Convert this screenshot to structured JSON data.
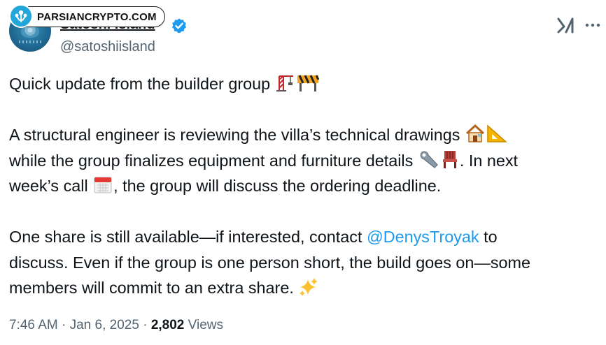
{
  "watermark": {
    "text": "PARSIANCRYPTO.COM"
  },
  "author": {
    "display_name": "Satoshi Island",
    "handle": "@satoshiisland",
    "verified": true,
    "avatar_icon": "island-avatar"
  },
  "tweet": {
    "line1": "Quick update from the builder group",
    "p2_a": "A structural engineer is reviewing the villa’s technical drawings",
    "p2_b": "while the group finalizes equipment and furniture details",
    "p2_c": ". In next",
    "p2_d": "week’s call",
    "p2_e": ", the group will discuss the ordering deadline.",
    "p3_a": "One share is still available—if interested, contact",
    "p3_mention": "@DenysTroyak",
    "p3_b": "to",
    "p3_c": "discuss. Even if the group is one person short, the build goes on—some",
    "p3_d": "members will commit to an extra share.",
    "emojis": [
      "crane-emoji",
      "construction-barrier-emoji",
      "house-emoji",
      "triangular-ruler-emoji",
      "wrench-emoji",
      "chair-emoji",
      "calendar-emoji",
      "sparkles-emoji"
    ]
  },
  "meta": {
    "time": "7:46 AM",
    "sep1": "·",
    "date": "Jan 6, 2025",
    "sep2": "·",
    "views_count": "2,802",
    "views_label": "Views"
  },
  "colors": {
    "text": "#0f1419",
    "secondary": "#536471",
    "link": "#1d9bf0",
    "verified": "#1d9bf0"
  }
}
